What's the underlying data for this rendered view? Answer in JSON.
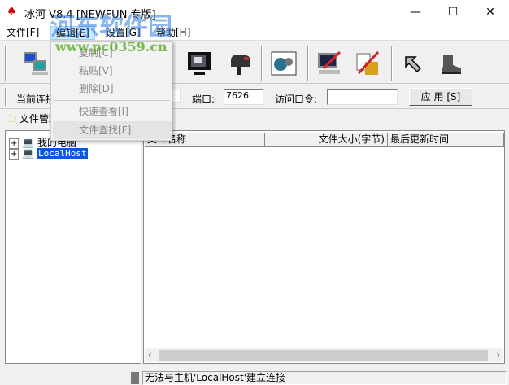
{
  "window": {
    "title": "冰河 V8.4 [NEWFUN 专版]",
    "minimize": "—",
    "maximize": "☐",
    "close": "✕"
  },
  "menu": [
    "文件[F]",
    "编辑[E]",
    "设置[G]",
    "帮助[H]"
  ],
  "edit_menu": {
    "items": [
      "复制[C]",
      "粘贴[V]",
      "删除[D]",
      "快速查看[I]",
      "文件查找[F]"
    ]
  },
  "connect": {
    "current_label": "当前连接",
    "port_label": "端口:",
    "port_value": "7626",
    "password_label": "访问口令:",
    "password_value": "",
    "apply": "应 用 [S]"
  },
  "file_manager": {
    "label": "文件管理器"
  },
  "tree": [
    {
      "label": "我的电脑",
      "selected": false
    },
    {
      "label": "LocalHost",
      "selected": true
    }
  ],
  "list": {
    "columns": [
      "文件名称",
      "文件大小(字节)",
      "最后更新时间"
    ]
  },
  "status": {
    "message": "无法与主机'LocalHost'建立连接"
  },
  "watermark": {
    "title": "河东软件园",
    "url": "www.pc0359.cn"
  }
}
